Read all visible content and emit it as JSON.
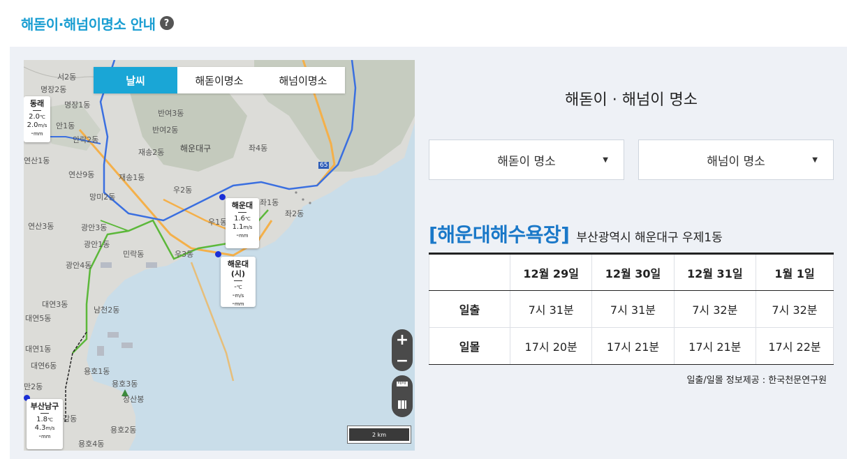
{
  "header": {
    "title": "해돋이·해넘이명소 안내",
    "help_icon": "question-circle-icon",
    "help_glyph": "?"
  },
  "map": {
    "tabs": [
      {
        "label": "날씨",
        "active": true
      },
      {
        "label": "해돋이명소",
        "active": false
      },
      {
        "label": "해넘이명소",
        "active": false
      }
    ],
    "stations": [
      {
        "name": "동래",
        "temp": "2.0",
        "temp_unit": "℃",
        "wind": "2.0",
        "wind_unit": "m/s",
        "rain": "-",
        "rain_unit": "mm"
      },
      {
        "name": "해운대",
        "temp": "1.6",
        "temp_unit": "℃",
        "wind": "1.1",
        "wind_unit": "m/s",
        "rain": "-",
        "rain_unit": "mm"
      },
      {
        "name": "해운대(시)",
        "temp": "-",
        "temp_unit": "℃",
        "wind": "-",
        "wind_unit": "m/s",
        "rain": "-",
        "rain_unit": "mm"
      },
      {
        "name": "부산남구",
        "temp": "1.8",
        "temp_unit": "℃",
        "wind": "4.3",
        "wind_unit": "m/s",
        "rain": "-",
        "rain_unit": "mm"
      }
    ],
    "labels": {
      "seo2": "서2동",
      "myeongjang2": "명장2동",
      "myeongjang1": "명장1동",
      "an1": "안1동",
      "anrak2": "안락2동",
      "yeonsan1": "연산1동",
      "yeonsan9": "연산9동",
      "mangmi2": "망미2동",
      "yeonsan3": "연산3동",
      "gwangan3": "광안3동",
      "gwangan1": "광안1동",
      "gwangan4": "광안4동",
      "minrak": "민락동",
      "daeyeon3": "대연3동",
      "daeyeon5": "대연5동",
      "daeyeon1": "대연1동",
      "daeyeon6": "대연6동",
      "namcheon2": "남천2동",
      "yongho1": "용호1동",
      "yongho3": "용호3동",
      "jangsanbong": "장산봉",
      "yongho2": "용호2동",
      "yongho4": "용호4동",
      "man2": "만2동",
      "gamdong": "감동",
      "banyeo3": "반여3동",
      "banyeo2": "반여2동",
      "jaesong2": "재송2동",
      "haeundaegu": "해운대구",
      "jwa4": "좌4동",
      "jaesong1": "재송1동",
      "u2": "우2동",
      "jwa1": "좌1동",
      "jwa2": "좌2동",
      "u1": "우1동",
      "u3": "우3동",
      "route65": "65"
    },
    "zoom_in": "+",
    "zoom_out": "−",
    "ruler_icon": "ruler-icon",
    "layers_icon": "map-layers-icon",
    "scale_label": "2 km"
  },
  "panel": {
    "title": "해돋이 · 해넘이 명소",
    "sunrise_select": "해돋이 명소",
    "sunset_select": "해넘이 명소",
    "select_arrow": "▼",
    "place_name": "[해운대해수욕장]",
    "place_address": "부산광역시 해운대구 우제1동",
    "table": {
      "dates": [
        "12월 29일",
        "12월 30일",
        "12월 31일",
        "1월 1일"
      ],
      "rows": [
        {
          "label": "일출",
          "values": [
            "7시 31분",
            "7시 31분",
            "7시 32분",
            "7시 32분"
          ]
        },
        {
          "label": "일몰",
          "values": [
            "17시 20분",
            "17시 21분",
            "17시 21분",
            "17시 22분"
          ]
        }
      ]
    },
    "credit": "일출/일몰 정보제공 : 한국천문연구원"
  },
  "colors": {
    "accent": "#1aa6d6",
    "title": "#1a9ed2",
    "place": "#1a78c8",
    "station_dot": "#1b2fd6"
  }
}
